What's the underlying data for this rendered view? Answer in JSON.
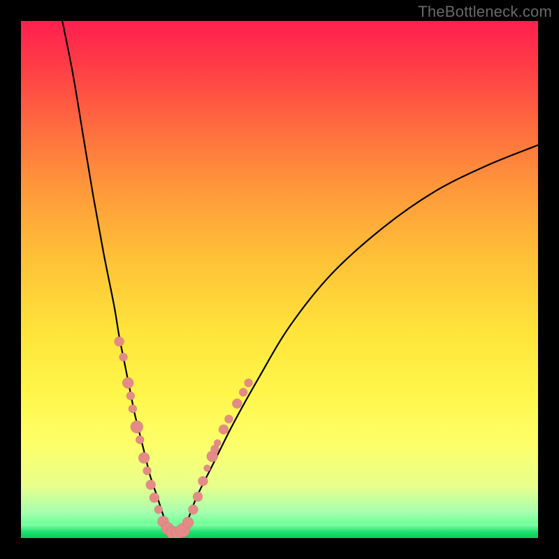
{
  "watermark": "TheBottleneck.com",
  "chart_data": {
    "type": "line",
    "title": "",
    "xlabel": "",
    "ylabel": "",
    "xlim": [
      0,
      100
    ],
    "ylim": [
      0,
      100
    ],
    "grid": false,
    "legend": false,
    "series": [
      {
        "name": "left-curve",
        "x": [
          8,
          10,
          12,
          14,
          16,
          18,
          19,
          20,
          21,
          22,
          23,
          24,
          25,
          26,
          27,
          28,
          29
        ],
        "y": [
          100,
          90,
          78,
          66,
          55,
          45,
          39,
          34,
          29,
          24,
          20,
          16,
          12,
          9,
          6,
          3,
          1
        ]
      },
      {
        "name": "right-curve",
        "x": [
          29,
          30,
          32,
          34,
          37,
          41,
          46,
          52,
          60,
          70,
          80,
          90,
          100
        ],
        "y": [
          1,
          1,
          3,
          8,
          14,
          22,
          31,
          41,
          51,
          60,
          67,
          72,
          76
        ]
      }
    ],
    "scatter_points": {
      "name": "markers",
      "color": "#e58b87",
      "points": [
        {
          "x": 19.0,
          "y": 38.0,
          "r": 7
        },
        {
          "x": 19.8,
          "y": 35.0,
          "r": 6
        },
        {
          "x": 20.7,
          "y": 30.0,
          "r": 8
        },
        {
          "x": 21.2,
          "y": 27.5,
          "r": 6
        },
        {
          "x": 21.6,
          "y": 25.0,
          "r": 6
        },
        {
          "x": 22.4,
          "y": 21.5,
          "r": 9
        },
        {
          "x": 23.0,
          "y": 19.0,
          "r": 6
        },
        {
          "x": 23.8,
          "y": 15.5,
          "r": 8
        },
        {
          "x": 24.4,
          "y": 13.0,
          "r": 6
        },
        {
          "x": 25.1,
          "y": 10.3,
          "r": 7
        },
        {
          "x": 25.8,
          "y": 7.8,
          "r": 7
        },
        {
          "x": 26.6,
          "y": 5.5,
          "r": 6
        },
        {
          "x": 27.5,
          "y": 3.2,
          "r": 8
        },
        {
          "x": 28.4,
          "y": 1.8,
          "r": 9
        },
        {
          "x": 29.3,
          "y": 1.0,
          "r": 9
        },
        {
          "x": 30.3,
          "y": 1.0,
          "r": 9
        },
        {
          "x": 31.3,
          "y": 1.5,
          "r": 10
        },
        {
          "x": 32.3,
          "y": 3.0,
          "r": 8
        },
        {
          "x": 33.3,
          "y": 5.5,
          "r": 7
        },
        {
          "x": 34.2,
          "y": 8.0,
          "r": 7
        },
        {
          "x": 35.2,
          "y": 11.0,
          "r": 7
        },
        {
          "x": 36.0,
          "y": 13.5,
          "r": 5
        },
        {
          "x": 37.0,
          "y": 15.8,
          "r": 8
        },
        {
          "x": 37.5,
          "y": 17.2,
          "r": 6
        },
        {
          "x": 38.0,
          "y": 18.4,
          "r": 5
        },
        {
          "x": 39.2,
          "y": 21.0,
          "r": 7
        },
        {
          "x": 40.2,
          "y": 23.0,
          "r": 6
        },
        {
          "x": 41.8,
          "y": 26.0,
          "r": 7
        },
        {
          "x": 43.0,
          "y": 28.2,
          "r": 6
        },
        {
          "x": 44.0,
          "y": 30.0,
          "r": 6
        }
      ]
    },
    "background_gradient": {
      "top": "#ff1f4f",
      "mid": "#fff64a",
      "bottom": "#18e06a"
    }
  }
}
